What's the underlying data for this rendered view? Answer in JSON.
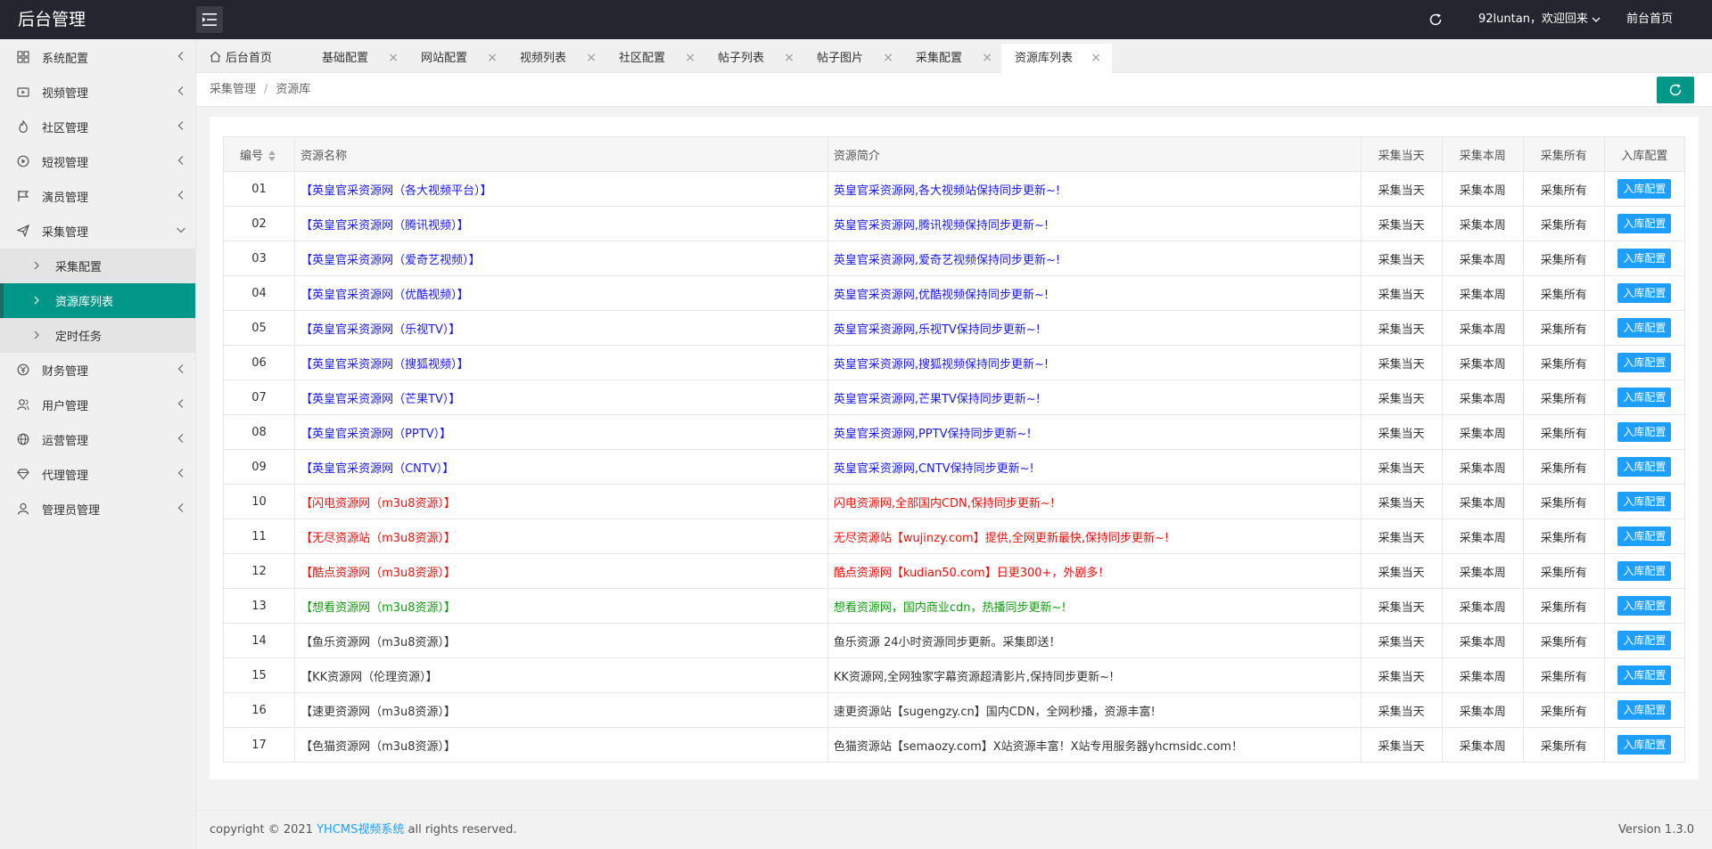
{
  "header": {
    "logo": "后台管理",
    "user": "92luntan，欢迎回来",
    "front_link": "前台首页"
  },
  "sidebar": {
    "items": [
      {
        "label": "系统配置",
        "icon": "dashboard-icon",
        "expanded": false
      },
      {
        "label": "视频管理",
        "icon": "video-icon",
        "expanded": false
      },
      {
        "label": "社区管理",
        "icon": "fire-icon",
        "expanded": false
      },
      {
        "label": "短视管理",
        "icon": "play-circle-icon",
        "expanded": false
      },
      {
        "label": "演员管理",
        "icon": "flag-icon",
        "expanded": false
      },
      {
        "label": "采集管理",
        "icon": "send-icon",
        "expanded": true,
        "children": [
          {
            "label": "采集配置",
            "active": false
          },
          {
            "label": "资源库列表",
            "active": true
          },
          {
            "label": "定时任务",
            "active": false
          }
        ]
      },
      {
        "label": "财务管理",
        "icon": "money-icon",
        "expanded": false
      },
      {
        "label": "用户管理",
        "icon": "users-icon",
        "expanded": false
      },
      {
        "label": "运营管理",
        "icon": "globe-icon",
        "expanded": false
      },
      {
        "label": "代理管理",
        "icon": "diamond-icon",
        "expanded": false
      },
      {
        "label": "管理员管理",
        "icon": "user-icon",
        "expanded": false
      }
    ]
  },
  "tabs": [
    {
      "label": "后台首页",
      "closable": false,
      "active": false
    },
    {
      "label": "基础配置",
      "closable": true,
      "active": false
    },
    {
      "label": "网站配置",
      "closable": true,
      "active": false
    },
    {
      "label": "视频列表",
      "closable": true,
      "active": false
    },
    {
      "label": "社区配置",
      "closable": true,
      "active": false
    },
    {
      "label": "帖子列表",
      "closable": true,
      "active": false
    },
    {
      "label": "帖子图片",
      "closable": true,
      "active": false
    },
    {
      "label": "采集配置",
      "closable": true,
      "active": false
    },
    {
      "label": "资源库列表",
      "closable": true,
      "active": true
    }
  ],
  "tab_close_glyph": "×",
  "breadcrumb": {
    "parent": "采集管理",
    "separator": "/",
    "current": "资源库"
  },
  "table": {
    "headers": {
      "id": "编号",
      "name": "资源名称",
      "desc": "资源简介",
      "today": "采集当天",
      "week": "采集本周",
      "all": "采集所有",
      "config": "入库配置"
    },
    "rows": [
      {
        "id": "01",
        "name": "【英皇官采资源网（各大视频平台）】",
        "desc": "英皇官采资源网,各大视频站保持同步更新~!",
        "color": "blue"
      },
      {
        "id": "02",
        "name": "【英皇官采资源网（腾讯视频）】",
        "desc": "英皇官采资源网,腾讯视频保持同步更新~!",
        "color": "blue"
      },
      {
        "id": "03",
        "name": "【英皇官采资源网（爱奇艺视频）】",
        "desc": "英皇官采资源网,爱奇艺视频保持同步更新~!",
        "color": "blue"
      },
      {
        "id": "04",
        "name": "【英皇官采资源网（优酷视频）】",
        "desc": "英皇官采资源网,优酷视频保持同步更新~!",
        "color": "blue"
      },
      {
        "id": "05",
        "name": "【英皇官采资源网（乐视TV）】",
        "desc": "英皇官采资源网,乐视TV保持同步更新~!",
        "color": "blue"
      },
      {
        "id": "06",
        "name": "【英皇官采资源网（搜狐视频）】",
        "desc": "英皇官采资源网,搜狐视频保持同步更新~!",
        "color": "blue"
      },
      {
        "id": "07",
        "name": "【英皇官采资源网（芒果TV）】",
        "desc": "英皇官采资源网,芒果TV保持同步更新~!",
        "color": "blue"
      },
      {
        "id": "08",
        "name": "【英皇官采资源网（PPTV）】",
        "desc": "英皇官采资源网,PPTV保持同步更新~!",
        "color": "blue"
      },
      {
        "id": "09",
        "name": "【英皇官采资源网（CNTV）】",
        "desc": "英皇官采资源网,CNTV保持同步更新~!",
        "color": "blue"
      },
      {
        "id": "10",
        "name": "【闪电资源网（m3u8资源）】",
        "desc": "闪电资源网,全部国内CDN,保持同步更新~!",
        "color": "red"
      },
      {
        "id": "11",
        "name": "【无尽资源站（m3u8资源）】",
        "desc": "无尽资源站【wujinzy.com】提供,全网更新最快,保持同步更新~!",
        "color": "red"
      },
      {
        "id": "12",
        "name": "【酷点资源网（m3u8资源）】",
        "desc": "酷点资源网【kudian50.com】日更300+，外剧多！",
        "color": "red"
      },
      {
        "id": "13",
        "name": "【想看资源网（m3u8资源）】",
        "desc": "想看资源网，国内商业cdn，热播同步更新~!",
        "color": "green"
      },
      {
        "id": "14",
        "name": "【鱼乐资源网（m3u8资源）】",
        "desc": "鱼乐资源 24小时资源同步更新。采集即送！",
        "color": "dark"
      },
      {
        "id": "15",
        "name": "【KK资源网（伦理资源）】",
        "desc": "KK资源网,全网独家字幕资源超清影片,保持同步更新~!",
        "color": "dark"
      },
      {
        "id": "16",
        "name": "【速更资源网（m3u8资源）】",
        "desc": "速更资源站【sugengzy.cn】国内CDN，全网秒播，资源丰富!",
        "color": "dark"
      },
      {
        "id": "17",
        "name": "【色猫资源网（m3u8资源）】",
        "desc": "色猫资源站【semaozy.com】X站资源丰富！X站专用服务器yhcmsidc.com！",
        "color": "dark"
      }
    ],
    "action_today": "采集当天",
    "action_week": "采集本周",
    "action_all": "采集所有",
    "config_btn": "入库配置"
  },
  "footer": {
    "copy_prefix": "copyright © 2021",
    "brand": "YHCMS视频系统",
    "copy_suffix": "all rights reserved.",
    "version": "Version 1.3.0"
  },
  "colors": {
    "primary": "#009688",
    "blue_btn": "#1e9fff",
    "topbar": "#23262e"
  }
}
